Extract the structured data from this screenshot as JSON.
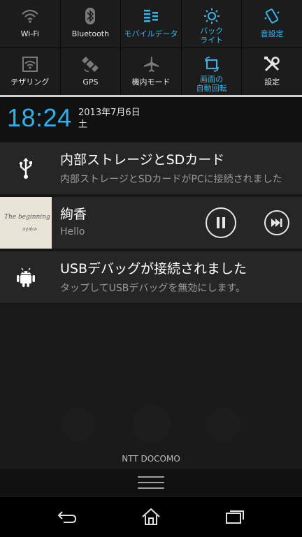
{
  "quick_settings": {
    "row1": [
      {
        "id": "wifi",
        "label": "Wi-Fi",
        "active": false,
        "icon": "wifi-icon"
      },
      {
        "id": "bluetooth",
        "label": "Bluetooth",
        "active": false,
        "icon": "bluetooth-icon"
      },
      {
        "id": "mobile-data",
        "label": "モバイルデータ",
        "active": true,
        "icon": "mobile-data-icon"
      },
      {
        "id": "backlight",
        "label": "バック\nライト",
        "active": true,
        "icon": "brightness-icon"
      },
      {
        "id": "sound",
        "label": "音設定",
        "active": true,
        "icon": "vibrate-icon"
      }
    ],
    "row2": [
      {
        "id": "tethering",
        "label": "テザリング",
        "active": false,
        "icon": "tethering-icon"
      },
      {
        "id": "gps",
        "label": "GPS",
        "active": false,
        "icon": "gps-satellite-icon"
      },
      {
        "id": "airplane",
        "label": "機内モード",
        "active": false,
        "icon": "airplane-icon"
      },
      {
        "id": "rotation",
        "label": "画面の\n自動回転",
        "active": true,
        "icon": "rotate-icon"
      },
      {
        "id": "settings",
        "label": "設定",
        "active": false,
        "icon": "tools-icon"
      }
    ]
  },
  "header": {
    "time": "18:24",
    "date": "2013年7月6日",
    "weekday": "土"
  },
  "notifications": [
    {
      "icon": "usb-icon",
      "title": "内部ストレージとSDカード",
      "text": "内部ストレージとSDカードがPCに接続されました"
    },
    {
      "icon": "album-art",
      "title": "絢香",
      "text": "Hello",
      "art_text": "The beginning",
      "art_sub": "ayaka"
    },
    {
      "icon": "android-icon",
      "title": "USBデバッグが接続されました",
      "text": "タップしてUSBデバッグを無効にします。"
    }
  ],
  "carrier": "NTT DOCOMO",
  "colors": {
    "accent": "#36b6ec",
    "clock": "#2fb0ea",
    "notification_bg": "#262626"
  }
}
